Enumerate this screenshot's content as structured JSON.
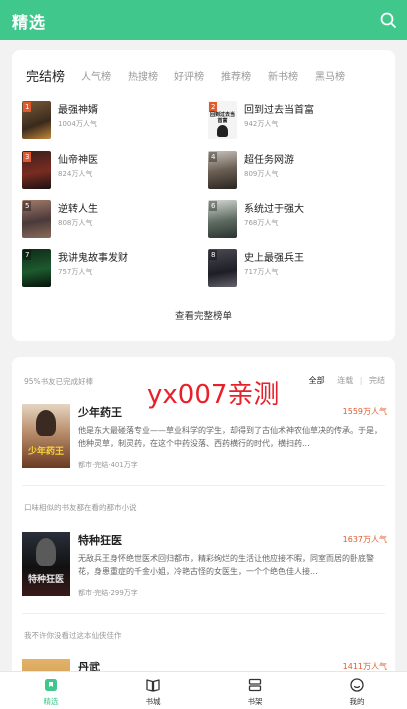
{
  "header": {
    "title": "精选",
    "search_icon": "search-icon",
    "bg_color": "#3fc78c"
  },
  "rank": {
    "tabs": [
      "完结榜",
      "人气榜",
      "热搜榜",
      "好评榜",
      "推荐榜",
      "新书榜",
      "黑马榜"
    ],
    "items": [
      {
        "num": "1",
        "title": "最强神婿",
        "popularity": "1004万人气"
      },
      {
        "num": "2",
        "title": "回到过去当首富",
        "popularity": "942万人气",
        "cover_text": "回到过去当首富"
      },
      {
        "num": "3",
        "title": "仙帝神医",
        "popularity": "824万人气"
      },
      {
        "num": "4",
        "title": "超任务网游",
        "popularity": "809万人气"
      },
      {
        "num": "5",
        "title": "逆转人生",
        "popularity": "808万人气"
      },
      {
        "num": "6",
        "title": "系统过于强大",
        "popularity": "768万人气"
      },
      {
        "num": "7",
        "title": "我讲鬼故事发财",
        "popularity": "757万人气"
      },
      {
        "num": "8",
        "title": "史上最强兵王",
        "popularity": "717万人气"
      }
    ],
    "view_full": "查看完整榜单"
  },
  "recommend": {
    "filters": [
      "全部",
      "连载",
      "完结"
    ],
    "sections": [
      {
        "title": "95%书友已完成好棒",
        "book": {
          "title": "少年药王",
          "popularity": "1559万人气",
          "desc": "他是东大最碰落专业——草业科学的学生，却得到了古仙术神农仙草决的传承。于是，他种灵草，制灵药，在这个中药没落、西药横行的时代，横扫药...",
          "meta": "都市·完结·401万字",
          "cover_text": "少年药王"
        }
      },
      {
        "title": "口味相似的书友都在看的都市小说",
        "book": {
          "title": "特种狂医",
          "popularity": "1637万人气",
          "desc": "无敌兵王身怀绝世医术回归都市，精彩绚烂的生活让他应接不暇，同室而居的卧底警花，身患重症的千金小姐，冷艳古怪的女医生，一个个绝色佳人接...",
          "meta": "都市·完结·299万字",
          "cover_text": "特种狂医"
        }
      },
      {
        "title": "我不许你没看过这本仙侠佳作",
        "book": {
          "title": "丹武",
          "popularity": "1411万人气"
        }
      }
    ]
  },
  "watermark": "yx007亲测",
  "tabbar": [
    {
      "label": "精选",
      "icon": "featured-icon",
      "active": true
    },
    {
      "label": "书城",
      "icon": "book-city-icon",
      "active": false
    },
    {
      "label": "书架",
      "icon": "bookshelf-icon",
      "active": false
    },
    {
      "label": "我的",
      "icon": "profile-icon",
      "active": false
    }
  ],
  "colors": {
    "accent": "#3fc78c",
    "popularity": "#e05a2b",
    "watermark": "#e8202a"
  }
}
